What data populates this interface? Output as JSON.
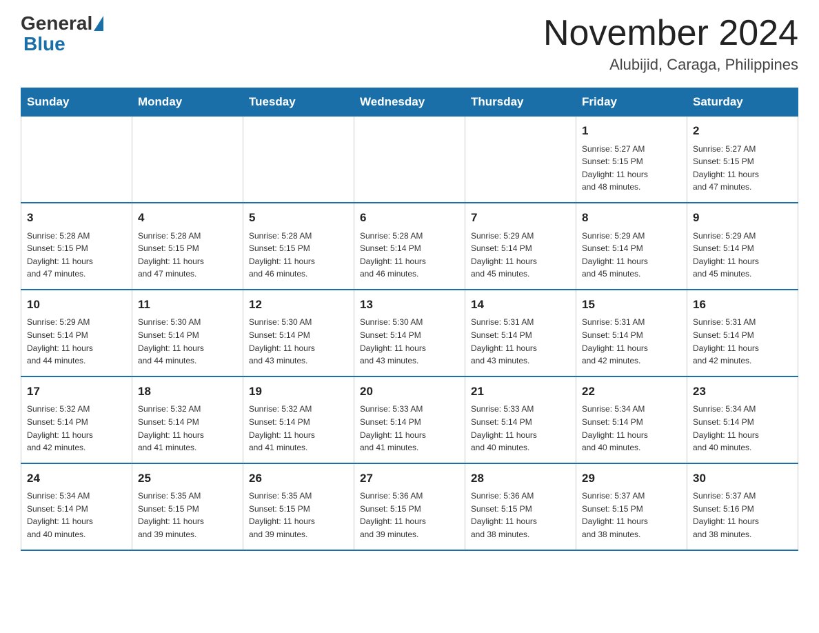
{
  "header": {
    "logo_general": "General",
    "logo_blue": "Blue",
    "month_title": "November 2024",
    "location": "Alubijid, Caraga, Philippines"
  },
  "days_of_week": [
    "Sunday",
    "Monday",
    "Tuesday",
    "Wednesday",
    "Thursday",
    "Friday",
    "Saturday"
  ],
  "weeks": [
    [
      {
        "day": "",
        "info": ""
      },
      {
        "day": "",
        "info": ""
      },
      {
        "day": "",
        "info": ""
      },
      {
        "day": "",
        "info": ""
      },
      {
        "day": "",
        "info": ""
      },
      {
        "day": "1",
        "info": "Sunrise: 5:27 AM\nSunset: 5:15 PM\nDaylight: 11 hours\nand 48 minutes."
      },
      {
        "day": "2",
        "info": "Sunrise: 5:27 AM\nSunset: 5:15 PM\nDaylight: 11 hours\nand 47 minutes."
      }
    ],
    [
      {
        "day": "3",
        "info": "Sunrise: 5:28 AM\nSunset: 5:15 PM\nDaylight: 11 hours\nand 47 minutes."
      },
      {
        "day": "4",
        "info": "Sunrise: 5:28 AM\nSunset: 5:15 PM\nDaylight: 11 hours\nand 47 minutes."
      },
      {
        "day": "5",
        "info": "Sunrise: 5:28 AM\nSunset: 5:15 PM\nDaylight: 11 hours\nand 46 minutes."
      },
      {
        "day": "6",
        "info": "Sunrise: 5:28 AM\nSunset: 5:14 PM\nDaylight: 11 hours\nand 46 minutes."
      },
      {
        "day": "7",
        "info": "Sunrise: 5:29 AM\nSunset: 5:14 PM\nDaylight: 11 hours\nand 45 minutes."
      },
      {
        "day": "8",
        "info": "Sunrise: 5:29 AM\nSunset: 5:14 PM\nDaylight: 11 hours\nand 45 minutes."
      },
      {
        "day": "9",
        "info": "Sunrise: 5:29 AM\nSunset: 5:14 PM\nDaylight: 11 hours\nand 45 minutes."
      }
    ],
    [
      {
        "day": "10",
        "info": "Sunrise: 5:29 AM\nSunset: 5:14 PM\nDaylight: 11 hours\nand 44 minutes."
      },
      {
        "day": "11",
        "info": "Sunrise: 5:30 AM\nSunset: 5:14 PM\nDaylight: 11 hours\nand 44 minutes."
      },
      {
        "day": "12",
        "info": "Sunrise: 5:30 AM\nSunset: 5:14 PM\nDaylight: 11 hours\nand 43 minutes."
      },
      {
        "day": "13",
        "info": "Sunrise: 5:30 AM\nSunset: 5:14 PM\nDaylight: 11 hours\nand 43 minutes."
      },
      {
        "day": "14",
        "info": "Sunrise: 5:31 AM\nSunset: 5:14 PM\nDaylight: 11 hours\nand 43 minutes."
      },
      {
        "day": "15",
        "info": "Sunrise: 5:31 AM\nSunset: 5:14 PM\nDaylight: 11 hours\nand 42 minutes."
      },
      {
        "day": "16",
        "info": "Sunrise: 5:31 AM\nSunset: 5:14 PM\nDaylight: 11 hours\nand 42 minutes."
      }
    ],
    [
      {
        "day": "17",
        "info": "Sunrise: 5:32 AM\nSunset: 5:14 PM\nDaylight: 11 hours\nand 42 minutes."
      },
      {
        "day": "18",
        "info": "Sunrise: 5:32 AM\nSunset: 5:14 PM\nDaylight: 11 hours\nand 41 minutes."
      },
      {
        "day": "19",
        "info": "Sunrise: 5:32 AM\nSunset: 5:14 PM\nDaylight: 11 hours\nand 41 minutes."
      },
      {
        "day": "20",
        "info": "Sunrise: 5:33 AM\nSunset: 5:14 PM\nDaylight: 11 hours\nand 41 minutes."
      },
      {
        "day": "21",
        "info": "Sunrise: 5:33 AM\nSunset: 5:14 PM\nDaylight: 11 hours\nand 40 minutes."
      },
      {
        "day": "22",
        "info": "Sunrise: 5:34 AM\nSunset: 5:14 PM\nDaylight: 11 hours\nand 40 minutes."
      },
      {
        "day": "23",
        "info": "Sunrise: 5:34 AM\nSunset: 5:14 PM\nDaylight: 11 hours\nand 40 minutes."
      }
    ],
    [
      {
        "day": "24",
        "info": "Sunrise: 5:34 AM\nSunset: 5:14 PM\nDaylight: 11 hours\nand 40 minutes."
      },
      {
        "day": "25",
        "info": "Sunrise: 5:35 AM\nSunset: 5:15 PM\nDaylight: 11 hours\nand 39 minutes."
      },
      {
        "day": "26",
        "info": "Sunrise: 5:35 AM\nSunset: 5:15 PM\nDaylight: 11 hours\nand 39 minutes."
      },
      {
        "day": "27",
        "info": "Sunrise: 5:36 AM\nSunset: 5:15 PM\nDaylight: 11 hours\nand 39 minutes."
      },
      {
        "day": "28",
        "info": "Sunrise: 5:36 AM\nSunset: 5:15 PM\nDaylight: 11 hours\nand 38 minutes."
      },
      {
        "day": "29",
        "info": "Sunrise: 5:37 AM\nSunset: 5:15 PM\nDaylight: 11 hours\nand 38 minutes."
      },
      {
        "day": "30",
        "info": "Sunrise: 5:37 AM\nSunset: 5:16 PM\nDaylight: 11 hours\nand 38 minutes."
      }
    ]
  ]
}
